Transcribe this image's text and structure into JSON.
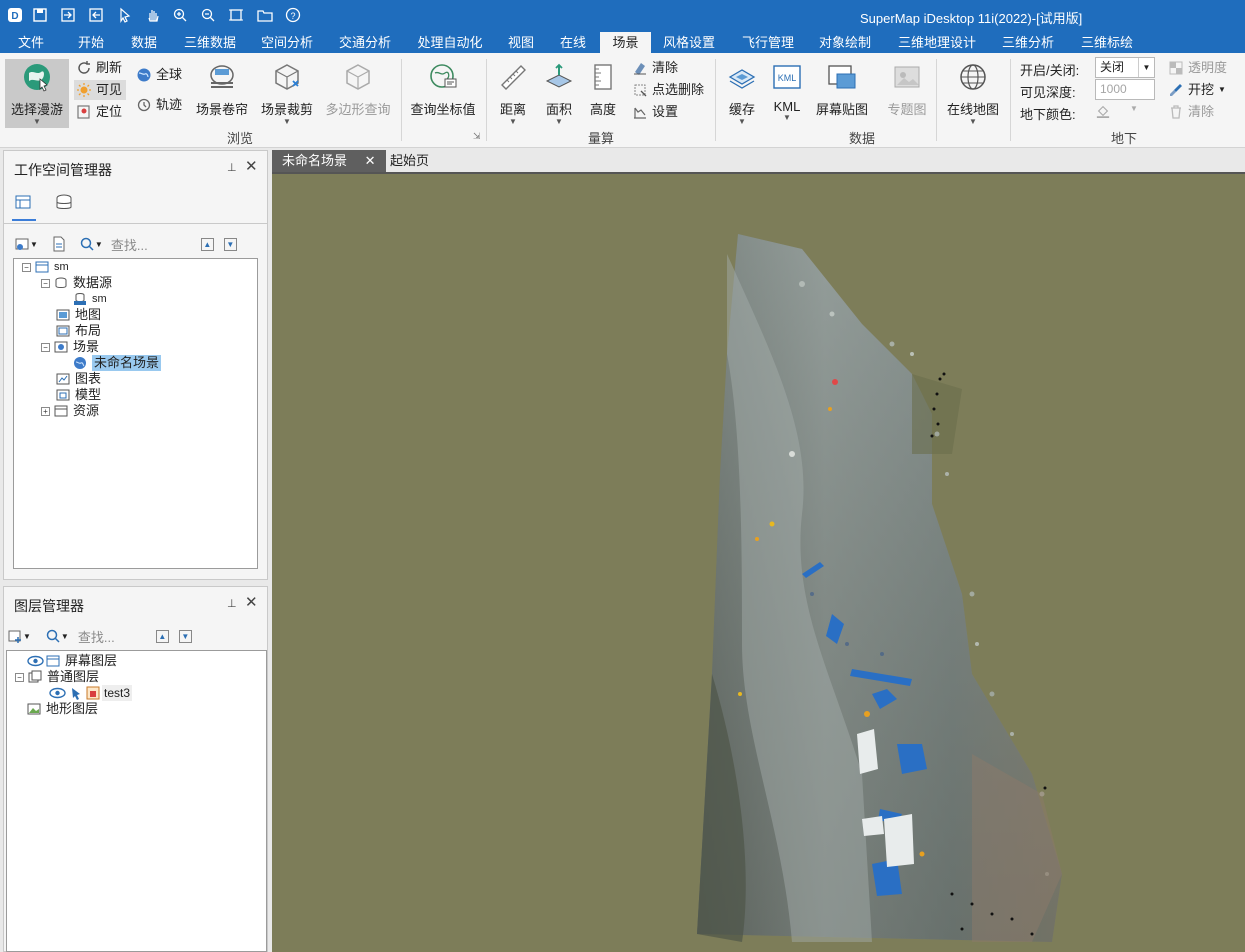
{
  "app": {
    "title": "SuperMap iDesktop 11i(2022)-[试用版]"
  },
  "quick_access": [
    "app-logo-icon",
    "save-icon",
    "import-icon",
    "export-icon",
    "select-pointer-icon",
    "pan-hand-icon",
    "zoom-in-icon",
    "zoom-out-icon",
    "full-extent-icon",
    "open-folder-icon",
    "help-icon"
  ],
  "menu_tabs": [
    "文件",
    "开始",
    "数据",
    "三维数据",
    "空间分析",
    "交通分析",
    "处理自动化",
    "视图",
    "在线",
    "场景",
    "风格设置",
    "飞行管理",
    "对象绘制",
    "三维地理设计",
    "三维分析",
    "三维标绘"
  ],
  "active_menu_tab": "场景",
  "ribbon": {
    "browse": {
      "label": "浏览",
      "select_roam": "选择漫游",
      "refresh": "刷新",
      "visible": "可见",
      "locate": "定位",
      "globe": "全球",
      "track": "轨迹",
      "scene_roller": "场景卷帘",
      "scene_clip": "场景裁剪",
      "polygon_query": "多边形查询",
      "query_coords": "查询坐标值"
    },
    "measure": {
      "label": "量算",
      "distance": "距离",
      "area": "面积",
      "height": "高度",
      "clear": "清除",
      "point_delete": "点选删除",
      "settings": "设置"
    },
    "data": {
      "label": "数据",
      "cache": "缓存",
      "kml": "KML",
      "kml_icon_text": "KML",
      "screen_texture": "屏幕贴图",
      "thematic_map": "专题图",
      "online_map": "在线地图"
    },
    "underground": {
      "label": "地下",
      "onoff_label": "开启/关闭:",
      "onoff_value": "关闭",
      "depth_label": "可见深度:",
      "depth_placeholder": "1000",
      "color_label": "地下颜色:",
      "transparency": "透明度",
      "excavate": "开挖",
      "clear": "清除"
    }
  },
  "workspace_panel": {
    "title": "工作空间管理器",
    "search_placeholder": "查找...",
    "tree": {
      "root": "sm",
      "datasource": "数据源",
      "datasource_child": "sm",
      "map": "地图",
      "layout": "布局",
      "scene": "场景",
      "scene_child": "未命名场景",
      "chart": "图表",
      "model": "模型",
      "resources": "资源"
    }
  },
  "layer_panel": {
    "title": "图层管理器",
    "search_placeholder": "查找...",
    "tree": {
      "screen_layers": "屏幕图层",
      "normal_layers": "普通图层",
      "layer_test3": "test3",
      "terrain_layers": "地形图层"
    }
  },
  "doc_tabs": {
    "active": "未命名场景",
    "close": "✕",
    "start_page": "起始页"
  },
  "colors": {
    "title_bar": "#1f6dbd",
    "scene_background": "#7d7d59",
    "selection": "#99c9ef"
  }
}
